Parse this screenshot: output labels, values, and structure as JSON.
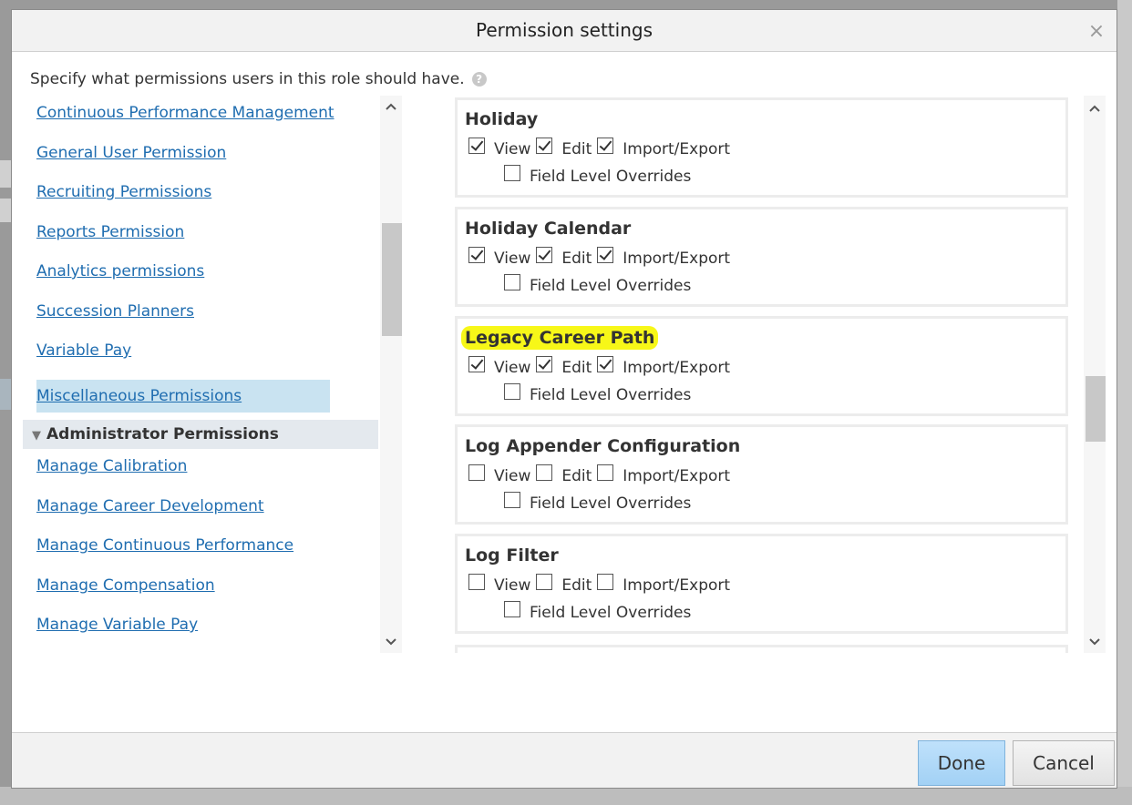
{
  "dialog": {
    "title": "Permission settings",
    "close_glyph": "×",
    "instructions": "Specify what permissions users in this role should have.",
    "help_glyph": "?"
  },
  "leftnav": {
    "items": [
      {
        "label": "Continuous Performance Management",
        "selected": false
      },
      {
        "label": "General User Permission",
        "selected": false
      },
      {
        "label": "Recruiting Permissions",
        "selected": false
      },
      {
        "label": "Reports Permission",
        "selected": false
      },
      {
        "label": "Analytics permissions",
        "selected": false
      },
      {
        "label": "Succession Planners",
        "selected": false
      },
      {
        "label": "Variable Pay",
        "selected": false
      },
      {
        "label": "Miscellaneous Permissions",
        "selected": true
      }
    ],
    "section": {
      "label": "Administrator Permissions",
      "glyph": "▼"
    },
    "admin_items": [
      {
        "label": "Manage Calibration"
      },
      {
        "label": "Manage Career Development"
      },
      {
        "label": "Manage Continuous Performance"
      },
      {
        "label": "Manage Compensation"
      },
      {
        "label": "Manage Variable Pay"
      }
    ]
  },
  "labels": {
    "view": "View",
    "edit": "Edit",
    "import_export": "Import/Export",
    "field_overrides": "Field Level Overrides"
  },
  "permissions": [
    {
      "title": "Holiday",
      "view": true,
      "edit": true,
      "import_export": true,
      "field_overrides": false,
      "highlight": false
    },
    {
      "title": "Holiday Calendar",
      "view": true,
      "edit": true,
      "import_export": true,
      "field_overrides": false,
      "highlight": false
    },
    {
      "title": "Legacy Career Path",
      "view": true,
      "edit": true,
      "import_export": true,
      "field_overrides": false,
      "highlight": true
    },
    {
      "title": "Log Appender Configuration",
      "view": false,
      "edit": false,
      "import_export": false,
      "field_overrides": false,
      "highlight": false
    },
    {
      "title": "Log Filter",
      "view": false,
      "edit": false,
      "import_export": false,
      "field_overrides": false,
      "highlight": false
    }
  ],
  "scroll": {
    "left_glyph_up": "⌃",
    "left_glyph_down": "⌄"
  },
  "footer": {
    "done_label": "Done",
    "cancel_label": "Cancel"
  },
  "colors": {
    "link": "#1f6db0",
    "selected_bg": "#c9e3f1",
    "highlight": "#f7f718",
    "done_bg": "#a2d1f5"
  }
}
